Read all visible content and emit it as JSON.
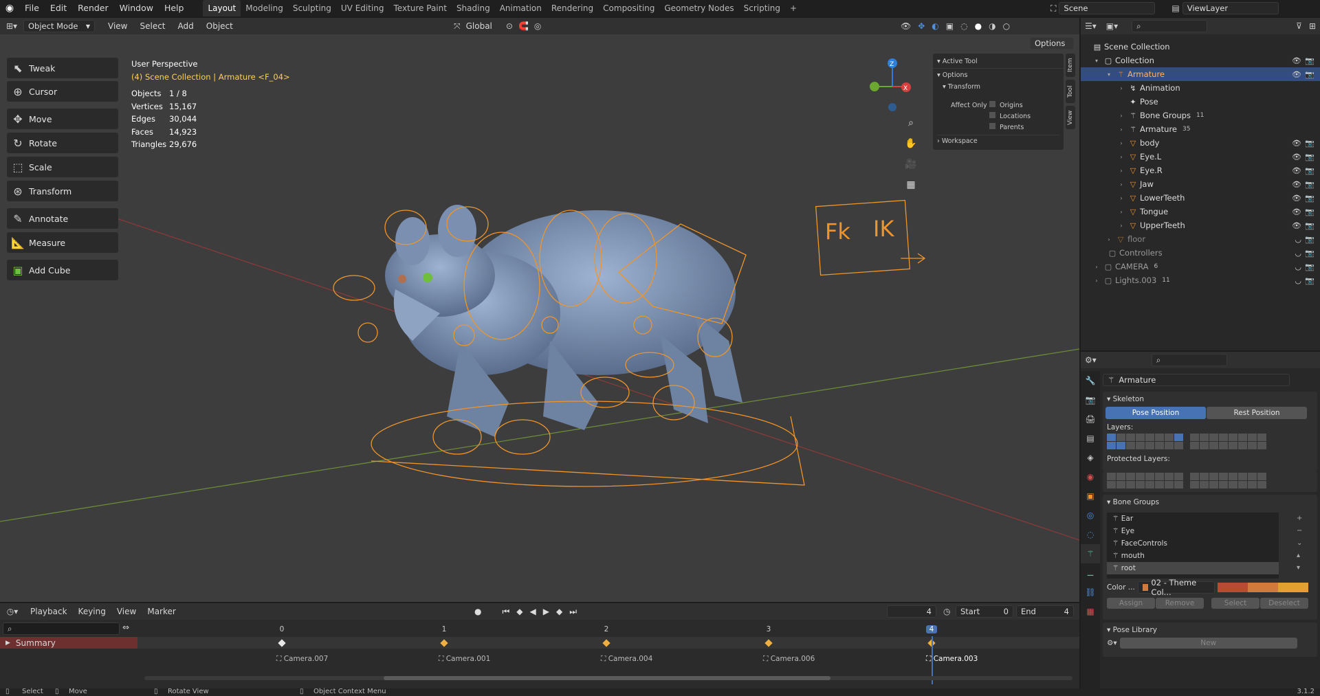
{
  "topbar": {
    "menus": [
      "File",
      "Edit",
      "Render",
      "Window",
      "Help"
    ],
    "workspaces": [
      "Layout",
      "Modeling",
      "Sculpting",
      "UV Editing",
      "Texture Paint",
      "Shading",
      "Animation",
      "Rendering",
      "Compositing",
      "Geometry Nodes",
      "Scripting"
    ],
    "active_workspace": "Layout",
    "scene": "Scene",
    "view_layer": "ViewLayer"
  },
  "viewport": {
    "mode": "Object Mode",
    "menus": [
      "View",
      "Select",
      "Add",
      "Object"
    ],
    "orientation": "Global",
    "options_label": "Options",
    "perspective": "User Perspective",
    "context": "(4) Scene Collection | Armature <F_04>",
    "stats": [
      {
        "k": "Objects",
        "v": "1 / 8"
      },
      {
        "k": "Vertices",
        "v": "15,167"
      },
      {
        "k": "Edges",
        "v": "30,044"
      },
      {
        "k": "Faces",
        "v": "14,923"
      },
      {
        "k": "Triangles",
        "v": "29,676"
      }
    ],
    "tools": [
      "Tweak",
      "Cursor",
      "Move",
      "Rotate",
      "Scale",
      "Transform",
      "Annotate",
      "Measure",
      "Add Cube"
    ],
    "fk_label": "Fk",
    "ik_label": "IK",
    "gizmo": {
      "z": "Z",
      "y": "Y",
      "x": "X"
    }
  },
  "npanel": {
    "active_tool": "Active Tool",
    "options": "Options",
    "transform": "Transform",
    "affect_only": "Affect Only",
    "checks": [
      "Origins",
      "Locations",
      "Parents"
    ],
    "workspace": "Workspace",
    "tabs": [
      "Item",
      "Tool",
      "View"
    ]
  },
  "outliner": {
    "rows": [
      {
        "label": "Scene Collection",
        "level": 0
      },
      {
        "label": "Collection",
        "level": 1
      },
      {
        "label": "Armature",
        "level": 2
      },
      {
        "label": "Animation",
        "level": 3
      },
      {
        "label": "Pose",
        "level": 3
      },
      {
        "label": "Bone Groups",
        "level": 3,
        "badge": "11"
      },
      {
        "label": "Armature",
        "level": 3,
        "badge": "35"
      },
      {
        "label": "body",
        "level": 3
      },
      {
        "label": "Eye.L",
        "level": 3
      },
      {
        "label": "Eye.R",
        "level": 3
      },
      {
        "label": "Jaw",
        "level": 3
      },
      {
        "label": "LowerTeeth",
        "level": 3
      },
      {
        "label": "Tongue",
        "level": 3
      },
      {
        "label": "UpperTeeth",
        "level": 3
      },
      {
        "label": "floor",
        "level": 2
      },
      {
        "label": "Controllers",
        "level": 1
      },
      {
        "label": "CAMERA",
        "level": 1,
        "badge": "6"
      },
      {
        "label": "Lights.003",
        "level": 1,
        "badge": "11"
      }
    ]
  },
  "properties": {
    "object_name": "Armature",
    "skeleton": "Skeleton",
    "pose_position": "Pose Position",
    "rest_position": "Rest Position",
    "layers": "Layers:",
    "protected_layers": "Protected Layers:",
    "bone_groups": "Bone Groups",
    "groups": [
      "Ear",
      "Eye",
      "FaceControls",
      "mouth",
      "root"
    ],
    "color_label": "Color ...",
    "color_set": "02 - Theme Col...",
    "assign": "Assign",
    "remove": "Remove",
    "select": "Select",
    "deselect": "Deselect",
    "pose_library": "Pose Library",
    "new": "New",
    "colors": {
      "c1": "#b94b35",
      "c2": "#d27a3a",
      "c3": "#e2a02f"
    }
  },
  "timeline": {
    "menus": [
      "Playback",
      "Keying",
      "View",
      "Marker"
    ],
    "current_frame": "4",
    "start_label": "Start",
    "start": "0",
    "end_label": "End",
    "end": "4",
    "summary": "Summary",
    "frames": [
      "0",
      "1",
      "2",
      "3",
      "4"
    ],
    "markers": [
      "Camera.007",
      "Camera.001",
      "Camera.004",
      "Camera.006",
      "Camera.003"
    ]
  },
  "statusbar": {
    "items": [
      "Select",
      "Move",
      "Rotate View",
      "Object Context Menu"
    ],
    "version": "3.1.2"
  }
}
